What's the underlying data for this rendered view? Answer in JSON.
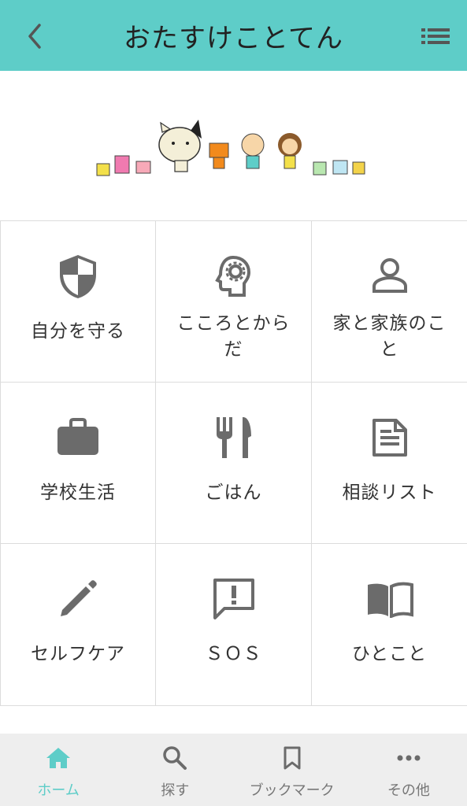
{
  "header": {
    "title": "おたすけことてん",
    "back_icon": "chevron-left-icon",
    "menu_icon": "list-icon",
    "background": "#5ecdc8"
  },
  "banner": {
    "illustration": "characters-illustration"
  },
  "menu": [
    {
      "label": "自分を守る",
      "icon": "shield-icon"
    },
    {
      "label": "こころとからだ",
      "icon": "head-gear-icon"
    },
    {
      "label": "家と家族のこと",
      "icon": "person-icon"
    },
    {
      "label": "学校生活",
      "icon": "briefcase-icon"
    },
    {
      "label": "ごはん",
      "icon": "fork-knife-icon"
    },
    {
      "label": "相談リスト",
      "icon": "document-icon"
    },
    {
      "label": "セルフケア",
      "icon": "pencil-icon"
    },
    {
      "label": "ＳＯＳ",
      "icon": "alert-message-icon"
    },
    {
      "label": "ひとこと",
      "icon": "open-book-icon"
    }
  ],
  "tabbar": {
    "tabs": [
      {
        "label": "ホーム",
        "icon": "home-icon",
        "active": true
      },
      {
        "label": "探す",
        "icon": "search-icon",
        "active": false
      },
      {
        "label": "ブックマーク",
        "icon": "bookmark-icon",
        "active": false
      },
      {
        "label": "その他",
        "icon": "more-icon",
        "active": false
      }
    ],
    "active_color": "#5ecdc8",
    "inactive_color": "#777777"
  }
}
